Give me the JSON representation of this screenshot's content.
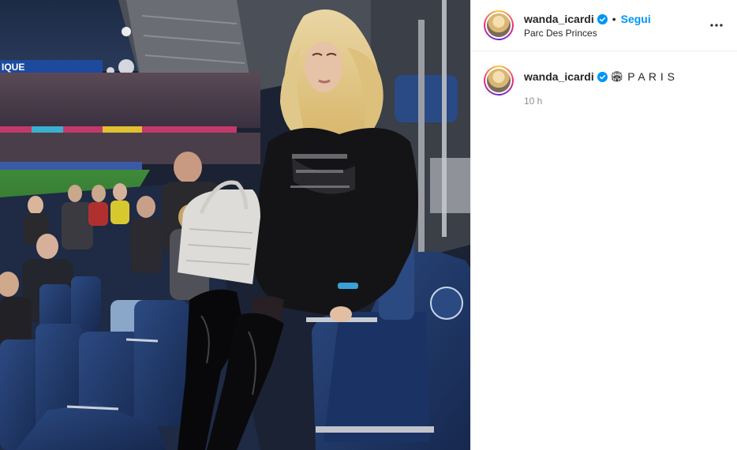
{
  "post": {
    "image_alt": "Woman in black hoodie and patent boots holding a white bag in a football stadium stand"
  },
  "header": {
    "username": "wanda_icardi",
    "separator": "•",
    "follow_label": "Segui",
    "location": "Parc Des Princes",
    "more_icon": "ellipsis-icon"
  },
  "caption": {
    "username": "wanda_icardi",
    "emoji": "🏟",
    "text": "P A R I S",
    "timestamp": "10 h"
  },
  "stadium_sign": {
    "text": "IQUE"
  },
  "colors": {
    "verified": "#0095f6",
    "follow": "#0095f6",
    "muted": "#8e8e8e"
  }
}
